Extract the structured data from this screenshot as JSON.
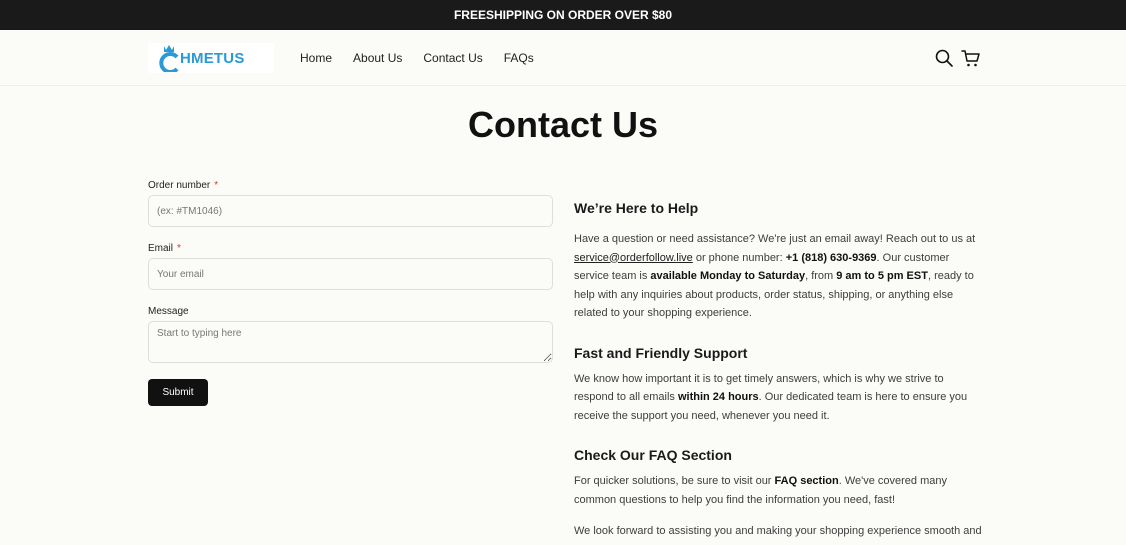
{
  "announcement": "FREESHIPPING ON ORDER OVER $80",
  "brand": {
    "name": "HMETUS",
    "accent": "#2a9ad6"
  },
  "nav": {
    "items": [
      "Home",
      "About Us",
      "Contact Us",
      "FAQs"
    ]
  },
  "header_icons": [
    "search-icon",
    "cart-icon"
  ],
  "page": {
    "title": "Contact Us"
  },
  "form": {
    "order": {
      "label": "Order number",
      "required_mark": "*",
      "placeholder": "(ex: #TM1046)"
    },
    "email": {
      "label": "Email",
      "required_mark": "*",
      "placeholder": "Your email"
    },
    "message": {
      "label": "Message",
      "placeholder": "Start to typing here"
    },
    "submit_label": "Submit"
  },
  "info": {
    "help": {
      "heading": "We’re Here to Help",
      "t1": "Have a question or need assistance? We're just an email away! Reach out to us at ",
      "email": "service@orderfollow.live",
      "t2": " or phone number: ",
      "phone": "+1 (818) 630-9369",
      "t3": ". Our customer service team is ",
      "days": "available Monday to Saturday",
      "t4": ", from ",
      "hours": "9 am to 5 pm EST",
      "t5": ", ready to help with any inquiries about products, order status, shipping, or anything else related to your shopping experience."
    },
    "support": {
      "heading": "Fast and Friendly Support",
      "t1": "We know how important it is to get timely answers, which is why we strive to respond to all emails ",
      "strong": "within 24 hours",
      "t2": ". Our dedicated team is here to ensure you receive the support you need, whenever you need it."
    },
    "faq": {
      "heading": "Check Our FAQ Section",
      "t1": "For quicker solutions, be sure to visit our ",
      "strong": "FAQ section",
      "t2": ". We've covered many common questions to help you find the information you need, fast!"
    },
    "closing": "We look forward to assisting you and making your shopping experience smooth and"
  }
}
